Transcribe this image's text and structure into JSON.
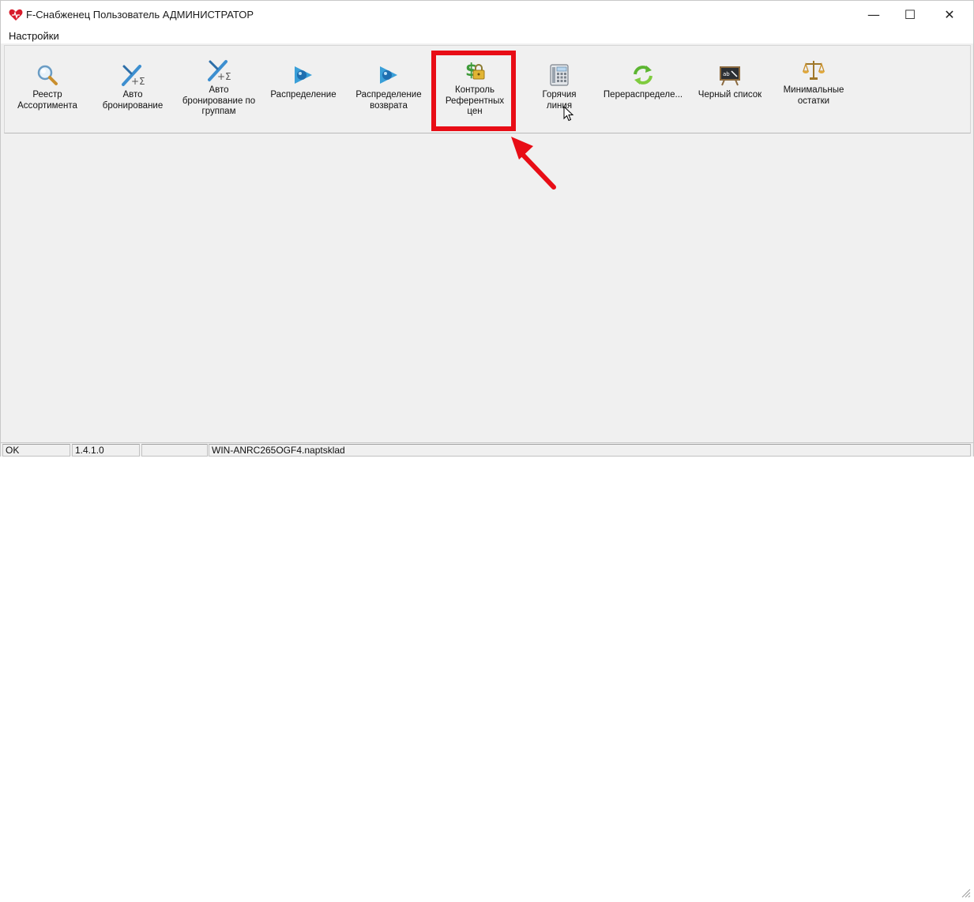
{
  "window": {
    "title": "F-Снабженец Пользователь АДМИНИСТРАТОР",
    "min_glyph": "—",
    "max_glyph": "☐",
    "close_glyph": "✕"
  },
  "menu": {
    "items": [
      {
        "label": "Настройки"
      }
    ]
  },
  "toolbar": {
    "buttons": [
      {
        "label": "Реестр\nАссортимента",
        "icon": "magnifier-icon"
      },
      {
        "label": "Авто\nбронирование",
        "icon": "auto-booking-icon"
      },
      {
        "label": "Авто\nбронирование по\nгруппам",
        "icon": "auto-booking-groups-icon"
      },
      {
        "label": "Распределение",
        "icon": "distribution-icon"
      },
      {
        "label": "Распределение\nвозврата",
        "icon": "return-distribution-icon"
      },
      {
        "label": "Контроль\nРеферентных\nцен",
        "icon": "money-lock-icon"
      },
      {
        "label": "Горячия\nлиния",
        "icon": "phone-icon"
      },
      {
        "label": "Перераспределе...",
        "icon": "redistribute-icon"
      },
      {
        "label": "Черный список",
        "icon": "blackboard-icon"
      },
      {
        "label": "Минимальные\nостатки",
        "icon": "scales-icon"
      }
    ]
  },
  "statusbar": {
    "status": "OK",
    "version": "1.4.1.0",
    "empty": "",
    "server": "WIN-ANRC265OGF4.naptsklad"
  },
  "colors": {
    "highlight": "#e80d16",
    "window_bg": "#f0f0f0"
  }
}
